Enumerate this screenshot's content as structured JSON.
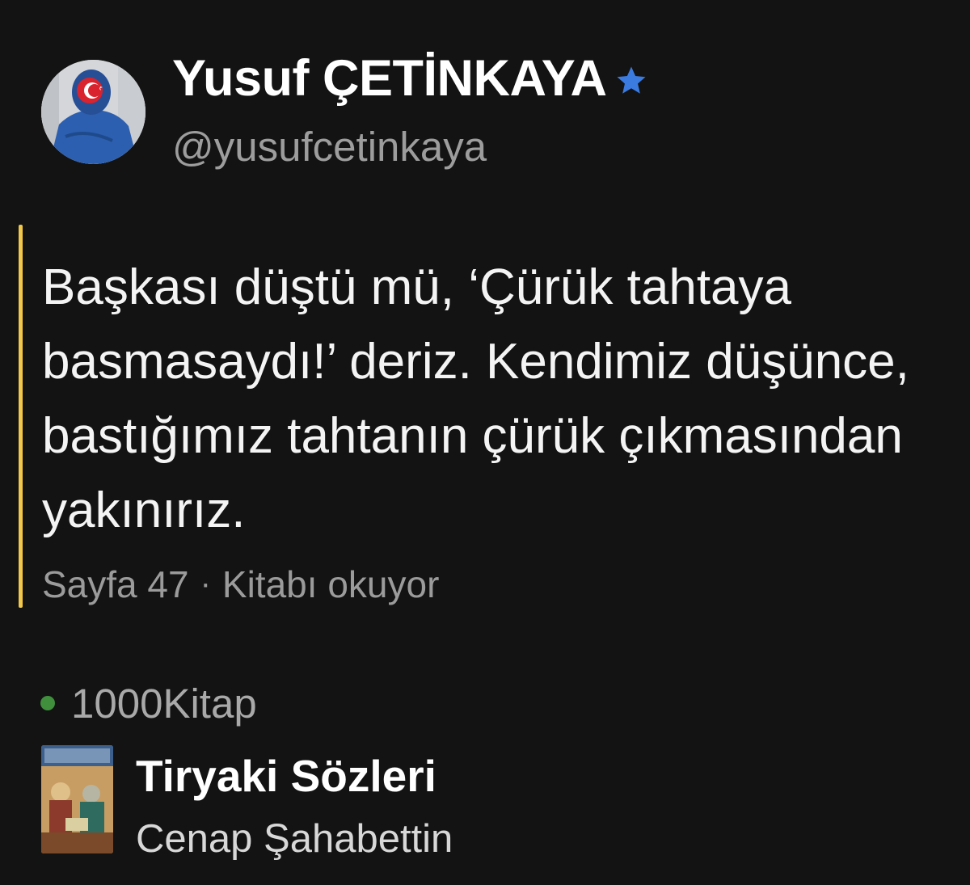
{
  "author": {
    "name": "Yusuf ÇETİNKAYA",
    "handle": "@yusufcetinkaya",
    "avatar_icon": "user-avatar",
    "verified_icon": "verified-star-icon"
  },
  "quote": {
    "text": "Başkası düştü mü, ‘Çürük tahtaya basmasaydı!’ deriz. Kendimiz düşünce, bastığımız tahtanın çürük çıkmasından yakınırız.",
    "page": "Sayfa 47",
    "separator": "·",
    "activity": "Kitabı okuyor",
    "accent_color": "#f1c84a"
  },
  "source": {
    "name": "1000Kitap",
    "status_color": "#3f8f3d"
  },
  "book": {
    "title": "Tiryaki Sözleri",
    "author": "Cenap Şahabettin",
    "cover_icon": "book-cover-image"
  }
}
